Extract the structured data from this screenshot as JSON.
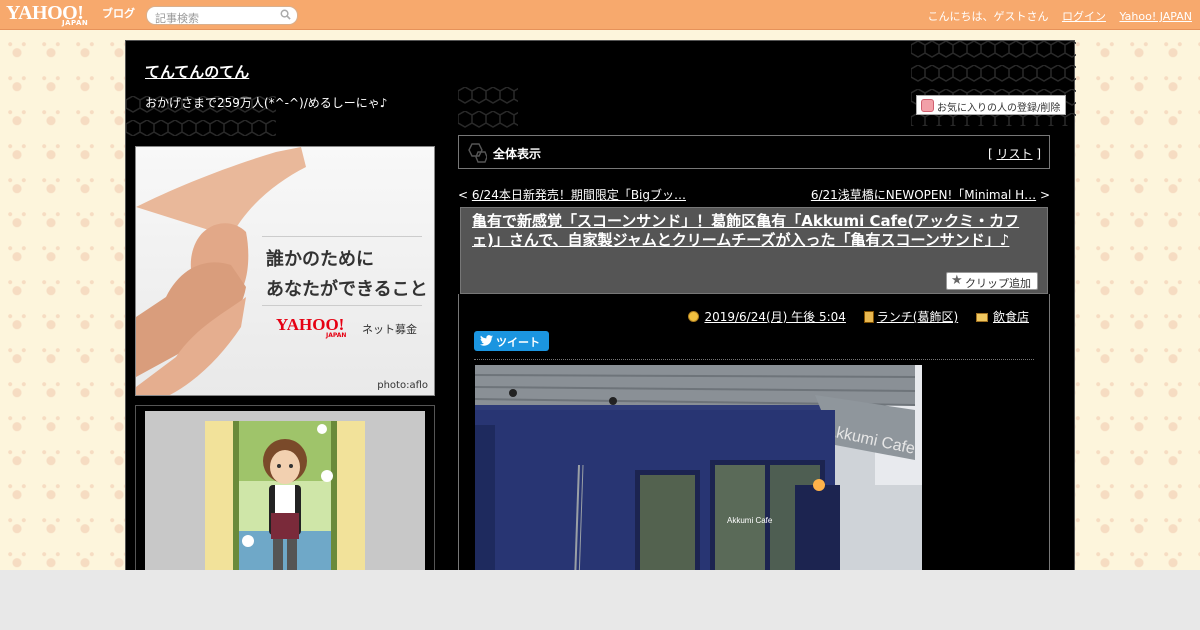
{
  "header": {
    "logo_main": "YAHOO!",
    "logo_sub": "JAPAN",
    "logo_service": "ブログ",
    "search_placeholder": "記事検索",
    "greeting": "こんにちは、ゲストさん",
    "login": "ログイン",
    "yahoo_japan": "Yahoo! JAPAN"
  },
  "blog": {
    "title": "てんてんのてん",
    "description": "おかげさまで259万人(*^-^)/めるしーにゃ♪"
  },
  "sidebar": {
    "ad": {
      "line1": "誰かのために",
      "line2": "あなたができること",
      "brand": "YAHOO!",
      "brand_sub": "JAPAN",
      "service": "ネット募金",
      "credit": "photo:aflo"
    }
  },
  "main": {
    "favorite_button": "お気に入りの人の登録/削除",
    "all_view_label": "全体表示",
    "list_link": "リスト",
    "prev_link": "6/24本日新発売！期間限定「Bigブッ…",
    "next_link": "6/21浅草橋にNEWOPEN!「Minimal H…",
    "entry": {
      "title": "亀有で新感覚「スコーンサンド」！葛飾区亀有「Akkumi Cafe(アックミ・カフェ)」さんで、自家製ジャムとクリームチーズが入った「亀有スコーンサンド」♪",
      "clip_button": "クリップ追加",
      "date": "2019/6/24(月) 午後 5:04",
      "category": "ランチ(葛飾区)",
      "folder": "飲食店",
      "tweet": "ツイート",
      "photo_sign": "Akkumi Cafe",
      "photo_door_sign": "Akkumi Cafe"
    }
  },
  "colors": {
    "header_bg": "#f7a96d",
    "container_bg": "#000000",
    "entry_head_bg": "#555555",
    "tweet_blue": "#1b95e0"
  }
}
